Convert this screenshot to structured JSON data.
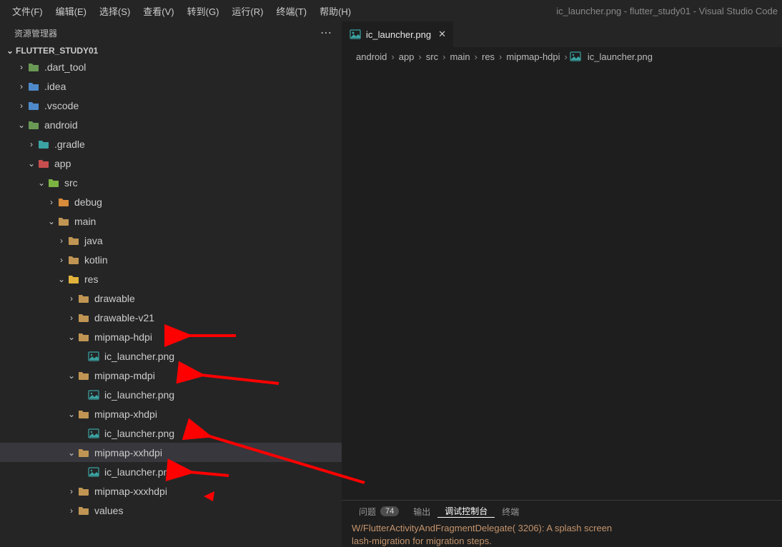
{
  "window_title": "ic_launcher.png - flutter_study01 - Visual Studio Code",
  "menu": [
    "文件(F)",
    "编辑(E)",
    "选择(S)",
    "查看(V)",
    "转到(G)",
    "运行(R)",
    "终端(T)",
    "帮助(H)"
  ],
  "sidebar_title": "资源管理器",
  "root_name": "FLUTTER_STUDY01",
  "tree": [
    {
      "depth": 0,
      "tw": ">",
      "icon": "folder-green",
      "label": ".dart_tool"
    },
    {
      "depth": 0,
      "tw": ">",
      "icon": "folder-blue",
      "label": ".idea"
    },
    {
      "depth": 0,
      "tw": ">",
      "icon": "folder-blue",
      "label": ".vscode"
    },
    {
      "depth": 0,
      "tw": "v",
      "icon": "folder-green",
      "label": "android"
    },
    {
      "depth": 1,
      "tw": ">",
      "icon": "folder-teal",
      "label": ".gradle"
    },
    {
      "depth": 1,
      "tw": "v",
      "icon": "folder-red",
      "label": "app"
    },
    {
      "depth": 2,
      "tw": "v",
      "icon": "folder-green2",
      "label": "src"
    },
    {
      "depth": 3,
      "tw": ">",
      "icon": "folder-orange",
      "label": "debug"
    },
    {
      "depth": 3,
      "tw": "v",
      "icon": "folder",
      "label": "main"
    },
    {
      "depth": 4,
      "tw": ">",
      "icon": "folder",
      "label": "java"
    },
    {
      "depth": 4,
      "tw": ">",
      "icon": "folder",
      "label": "kotlin"
    },
    {
      "depth": 4,
      "tw": "v",
      "icon": "folder-yellow",
      "label": "res"
    },
    {
      "depth": 5,
      "tw": ">",
      "icon": "folder",
      "label": "drawable"
    },
    {
      "depth": 5,
      "tw": ">",
      "icon": "folder",
      "label": "drawable-v21"
    },
    {
      "depth": 5,
      "tw": "v",
      "icon": "folder",
      "label": "mipmap-hdpi"
    },
    {
      "depth": 6,
      "tw": "",
      "icon": "image",
      "label": "ic_launcher.png"
    },
    {
      "depth": 5,
      "tw": "v",
      "icon": "folder",
      "label": "mipmap-mdpi"
    },
    {
      "depth": 6,
      "tw": "",
      "icon": "image",
      "label": "ic_launcher.png"
    },
    {
      "depth": 5,
      "tw": "v",
      "icon": "folder",
      "label": "mipmap-xhdpi"
    },
    {
      "depth": 6,
      "tw": "",
      "icon": "image",
      "label": "ic_launcher.png"
    },
    {
      "depth": 5,
      "tw": "v",
      "icon": "folder",
      "label": "mipmap-xxhdpi",
      "sel": true
    },
    {
      "depth": 6,
      "tw": "",
      "icon": "image",
      "label": "ic_launcher.png"
    },
    {
      "depth": 5,
      "tw": ">",
      "icon": "folder",
      "label": "mipmap-xxxhdpi"
    },
    {
      "depth": 5,
      "tw": ">",
      "icon": "folder",
      "label": "values"
    }
  ],
  "tab_label": "ic_launcher.png",
  "breadcrumbs": [
    "android",
    "app",
    "src",
    "main",
    "res",
    "mipmap-hdpi",
    "ic_launcher.png"
  ],
  "panel_tabs": [
    {
      "label": "问题",
      "badge": "74"
    },
    {
      "label": "输出"
    },
    {
      "label": "调试控制台",
      "active": true
    },
    {
      "label": "终端"
    }
  ],
  "terminal": [
    "W/FlutterActivityAndFragmentDelegate( 3206): A splash screen",
    "lash-migration for migration steps."
  ]
}
